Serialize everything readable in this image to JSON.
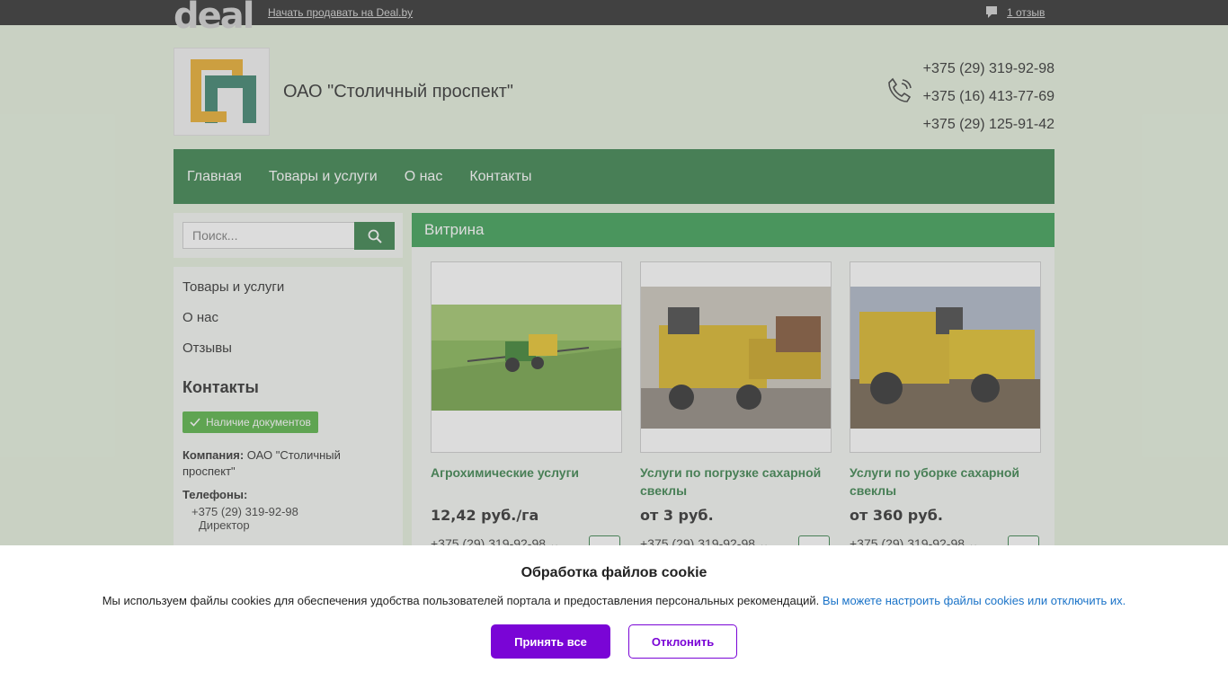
{
  "topbar": {
    "logo": "deal",
    "sell_link": "Начать продавать на Deal.by",
    "reviews": "1 отзыв",
    "reviews_icon": "comment-icon"
  },
  "header": {
    "company_name": "ОАО \"Столичный проспект\"",
    "phones": [
      "+375 (29) 319-92-98",
      "+375 (16) 413-77-69",
      "+375 (29) 125-91-42"
    ],
    "phone_icon": "phone-icon"
  },
  "nav": {
    "items": [
      "Главная",
      "Товары и услуги",
      "О нас",
      "Контакты"
    ]
  },
  "search": {
    "placeholder": "Поиск...",
    "icon": "search-icon"
  },
  "sidebar": {
    "items": [
      "Товары и услуги",
      "О нас",
      "Отзывы"
    ],
    "contacts_title": "Контакты",
    "doc_badge": "Наличие документов",
    "company_label": "Компания:",
    "company_value": "ОАО \"Столичный проспект\"",
    "phones_label": "Телефоны:",
    "phone": "+375 (29) 319-92-98",
    "phone_role": "Директор"
  },
  "main": {
    "title": "Витрина",
    "products": [
      {
        "name": "Агрохимические услуги",
        "price": "12,42 руб./га",
        "phone": "+375 (29) 319-92-98"
      },
      {
        "name": "Услуги по погрузке сахарной свеклы",
        "price": "от 3 руб.",
        "phone": "+375 (29) 319-92-98"
      },
      {
        "name": "Услуги по уборке сахарной свеклы",
        "price": "от 360 руб.",
        "phone": "+375 (29) 319-92-98"
      }
    ]
  },
  "cookie": {
    "title": "Обработка файлов cookie",
    "text": "Мы используем файлы cookies для обеспечения удобства пользователей портала и предоставления персональных рекомендаций.",
    "link": "Вы можете настроить файлы cookies или отключить их.",
    "accept": "Принять все",
    "decline": "Отклонить"
  },
  "colors": {
    "brand_green": "#2b7a3f",
    "title_green": "#2e9a4a",
    "accent_purple": "#7a05d6",
    "link_blue": "#1a73c8"
  }
}
